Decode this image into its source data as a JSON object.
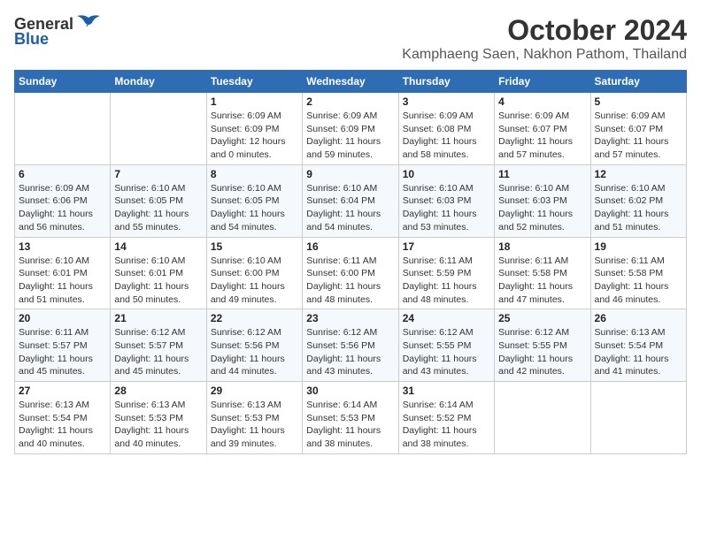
{
  "logo": {
    "general": "General",
    "blue": "Blue"
  },
  "title": "October 2024",
  "subtitle": "Kamphaeng Saen, Nakhon Pathom, Thailand",
  "days_header": [
    "Sunday",
    "Monday",
    "Tuesday",
    "Wednesday",
    "Thursday",
    "Friday",
    "Saturday"
  ],
  "weeks": [
    [
      {
        "day": "",
        "info": ""
      },
      {
        "day": "",
        "info": ""
      },
      {
        "day": "1",
        "info": "Sunrise: 6:09 AM\nSunset: 6:09 PM\nDaylight: 12 hours\nand 0 minutes."
      },
      {
        "day": "2",
        "info": "Sunrise: 6:09 AM\nSunset: 6:09 PM\nDaylight: 11 hours\nand 59 minutes."
      },
      {
        "day": "3",
        "info": "Sunrise: 6:09 AM\nSunset: 6:08 PM\nDaylight: 11 hours\nand 58 minutes."
      },
      {
        "day": "4",
        "info": "Sunrise: 6:09 AM\nSunset: 6:07 PM\nDaylight: 11 hours\nand 57 minutes."
      },
      {
        "day": "5",
        "info": "Sunrise: 6:09 AM\nSunset: 6:07 PM\nDaylight: 11 hours\nand 57 minutes."
      }
    ],
    [
      {
        "day": "6",
        "info": "Sunrise: 6:09 AM\nSunset: 6:06 PM\nDaylight: 11 hours\nand 56 minutes."
      },
      {
        "day": "7",
        "info": "Sunrise: 6:10 AM\nSunset: 6:05 PM\nDaylight: 11 hours\nand 55 minutes."
      },
      {
        "day": "8",
        "info": "Sunrise: 6:10 AM\nSunset: 6:05 PM\nDaylight: 11 hours\nand 54 minutes."
      },
      {
        "day": "9",
        "info": "Sunrise: 6:10 AM\nSunset: 6:04 PM\nDaylight: 11 hours\nand 54 minutes."
      },
      {
        "day": "10",
        "info": "Sunrise: 6:10 AM\nSunset: 6:03 PM\nDaylight: 11 hours\nand 53 minutes."
      },
      {
        "day": "11",
        "info": "Sunrise: 6:10 AM\nSunset: 6:03 PM\nDaylight: 11 hours\nand 52 minutes."
      },
      {
        "day": "12",
        "info": "Sunrise: 6:10 AM\nSunset: 6:02 PM\nDaylight: 11 hours\nand 51 minutes."
      }
    ],
    [
      {
        "day": "13",
        "info": "Sunrise: 6:10 AM\nSunset: 6:01 PM\nDaylight: 11 hours\nand 51 minutes."
      },
      {
        "day": "14",
        "info": "Sunrise: 6:10 AM\nSunset: 6:01 PM\nDaylight: 11 hours\nand 50 minutes."
      },
      {
        "day": "15",
        "info": "Sunrise: 6:10 AM\nSunset: 6:00 PM\nDaylight: 11 hours\nand 49 minutes."
      },
      {
        "day": "16",
        "info": "Sunrise: 6:11 AM\nSunset: 6:00 PM\nDaylight: 11 hours\nand 48 minutes."
      },
      {
        "day": "17",
        "info": "Sunrise: 6:11 AM\nSunset: 5:59 PM\nDaylight: 11 hours\nand 48 minutes."
      },
      {
        "day": "18",
        "info": "Sunrise: 6:11 AM\nSunset: 5:58 PM\nDaylight: 11 hours\nand 47 minutes."
      },
      {
        "day": "19",
        "info": "Sunrise: 6:11 AM\nSunset: 5:58 PM\nDaylight: 11 hours\nand 46 minutes."
      }
    ],
    [
      {
        "day": "20",
        "info": "Sunrise: 6:11 AM\nSunset: 5:57 PM\nDaylight: 11 hours\nand 45 minutes."
      },
      {
        "day": "21",
        "info": "Sunrise: 6:12 AM\nSunset: 5:57 PM\nDaylight: 11 hours\nand 45 minutes."
      },
      {
        "day": "22",
        "info": "Sunrise: 6:12 AM\nSunset: 5:56 PM\nDaylight: 11 hours\nand 44 minutes."
      },
      {
        "day": "23",
        "info": "Sunrise: 6:12 AM\nSunset: 5:56 PM\nDaylight: 11 hours\nand 43 minutes."
      },
      {
        "day": "24",
        "info": "Sunrise: 6:12 AM\nSunset: 5:55 PM\nDaylight: 11 hours\nand 43 minutes."
      },
      {
        "day": "25",
        "info": "Sunrise: 6:12 AM\nSunset: 5:55 PM\nDaylight: 11 hours\nand 42 minutes."
      },
      {
        "day": "26",
        "info": "Sunrise: 6:13 AM\nSunset: 5:54 PM\nDaylight: 11 hours\nand 41 minutes."
      }
    ],
    [
      {
        "day": "27",
        "info": "Sunrise: 6:13 AM\nSunset: 5:54 PM\nDaylight: 11 hours\nand 40 minutes."
      },
      {
        "day": "28",
        "info": "Sunrise: 6:13 AM\nSunset: 5:53 PM\nDaylight: 11 hours\nand 40 minutes."
      },
      {
        "day": "29",
        "info": "Sunrise: 6:13 AM\nSunset: 5:53 PM\nDaylight: 11 hours\nand 39 minutes."
      },
      {
        "day": "30",
        "info": "Sunrise: 6:14 AM\nSunset: 5:53 PM\nDaylight: 11 hours\nand 38 minutes."
      },
      {
        "day": "31",
        "info": "Sunrise: 6:14 AM\nSunset: 5:52 PM\nDaylight: 11 hours\nand 38 minutes."
      },
      {
        "day": "",
        "info": ""
      },
      {
        "day": "",
        "info": ""
      }
    ]
  ]
}
